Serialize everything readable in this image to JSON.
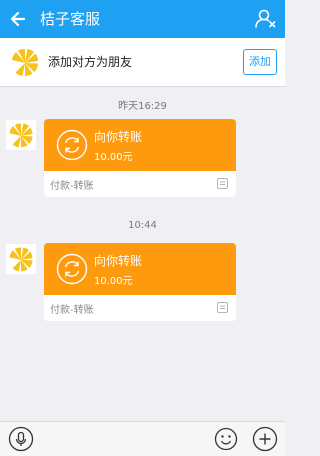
{
  "header": {
    "title": "桔子客服",
    "back_icon": "back-arrow-icon",
    "profile_icon": "person-icon",
    "bar_color": "#1ea1f2"
  },
  "friend_bar": {
    "text": "添加对方为朋友",
    "add_label": "添加"
  },
  "messages": [
    {
      "time": "昨天16:29",
      "title": "向你转账",
      "amount": "10.00元",
      "label": "付款-转账"
    },
    {
      "time": "10:44",
      "title": "向你转账",
      "amount": "10.00元",
      "label": "付款-转账"
    }
  ],
  "colors": {
    "accent": "#1ea1f2",
    "transfer_card": "#fd9a0e",
    "background": "#efeff4"
  },
  "input_bar": {
    "voice_icon": "microphone-icon",
    "emoji_icon": "smiley-icon",
    "plus_icon": "plus-icon"
  }
}
